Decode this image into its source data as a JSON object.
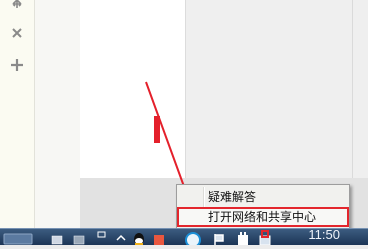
{
  "toolbar": {
    "tools": [
      {
        "icon": "move-icon"
      },
      {
        "icon": "close-icon"
      },
      {
        "icon": "add-icon"
      }
    ]
  },
  "context_menu": {
    "items": [
      {
        "label": "疑难解答",
        "highlighted": false
      },
      {
        "label": "打开网络和共享中心",
        "highlighted": true
      }
    ]
  },
  "taskbar": {
    "clock": "11:50",
    "icons": [
      "window-icon",
      "drive-icon",
      "chevron-up-icon",
      "qq-icon",
      "sogou-icon",
      "security-icon",
      "flag-icon",
      "power-icon",
      "network-icon"
    ]
  },
  "annotation": {
    "arrow_color": "#e4202b",
    "highlight_color": "#e3262d"
  }
}
